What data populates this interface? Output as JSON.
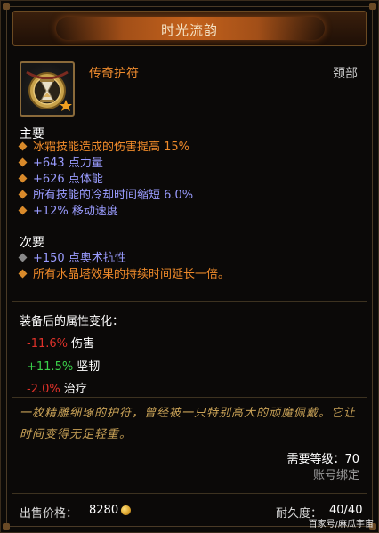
{
  "window": {
    "title": "时光流韵"
  },
  "item": {
    "name": "传奇护符",
    "slot": "颈部",
    "icon": "amulet-hourglass-icon"
  },
  "primary": {
    "heading": "主要",
    "affixes": [
      "冰霜技能造成的伤害提高 15%",
      "+643 点力量",
      "+626 点体能",
      "所有技能的冷却时间缩短 6.0%",
      "+12% 移动速度"
    ]
  },
  "secondary": {
    "heading": "次要",
    "affixes": [
      "+150 点奥术抗性",
      "所有水晶塔效果的持续时间延长一倍。"
    ]
  },
  "stat_changes": {
    "heading": "装备后的属性变化：",
    "rows": [
      {
        "value": "-11.6%",
        "label": "伤害"
      },
      {
        "value": "+11.5%",
        "label": "坚韧"
      },
      {
        "value": "-2.0%",
        "label": "治疗"
      }
    ]
  },
  "flavor_text": "一枚精雕细琢的护符，曾经被一只特别高大的顽魔佩戴。它让时间变得无足轻重。",
  "requirements": {
    "level": "需要等级：70",
    "binding": "账号绑定"
  },
  "footer": {
    "sell_label": "出售价格：",
    "sell_value": "8280",
    "durability_label": "耐久度：",
    "durability_value": "40/40"
  },
  "watermark": "百家号/麻瓜宇宙",
  "colors": {
    "legendary": "#ef8a2a",
    "magic": "#9a9cff",
    "positive": "#3ad04a",
    "negative": "#e0322a",
    "flavor": "#c9a257"
  }
}
